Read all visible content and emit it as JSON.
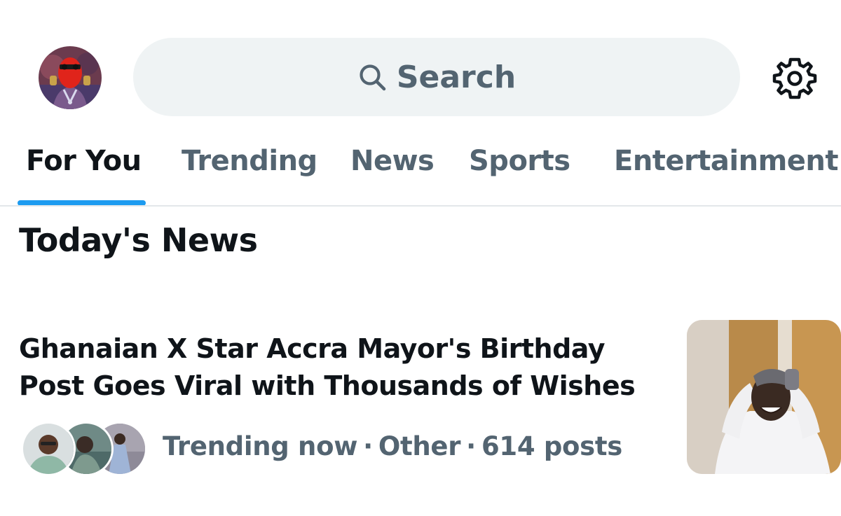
{
  "header": {
    "search_placeholder": "Search",
    "avatar_icon": "profile-avatar",
    "settings_icon": "gear-icon"
  },
  "tabs": [
    {
      "label": "For You",
      "active": true
    },
    {
      "label": "Trending",
      "active": false
    },
    {
      "label": "News",
      "active": false
    },
    {
      "label": "Sports",
      "active": false
    },
    {
      "label": "Entertainment",
      "active": false
    }
  ],
  "section": {
    "title": "Today's News"
  },
  "news": [
    {
      "headline_line1": "Ghanaian X Star Accra Mayor's Birthday",
      "headline_line2": "Post Goes Viral with Thousands of Wishes",
      "status": "Trending now",
      "category": "Other",
      "posts": "614 posts",
      "separator": "·"
    }
  ],
  "colors": {
    "accent": "#1d9bf0",
    "text_primary": "#0f1419",
    "text_secondary": "#536471",
    "search_bg": "#eff3f4"
  }
}
